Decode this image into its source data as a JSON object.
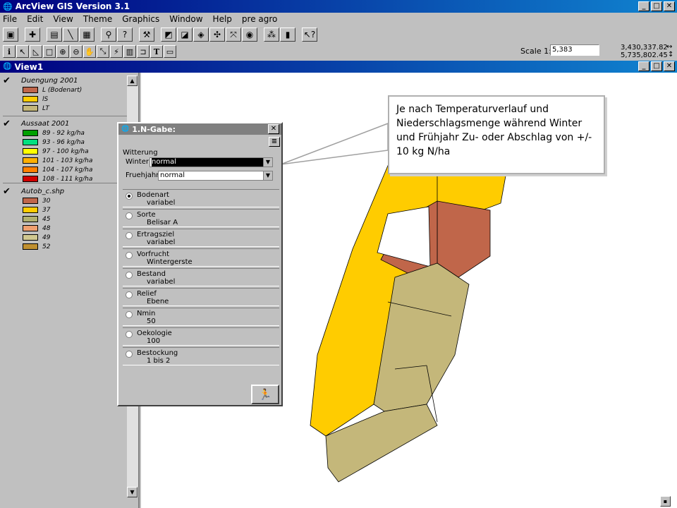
{
  "app": {
    "title": "ArcView GIS Version 3.1",
    "window_buttons": [
      "_",
      "□",
      "✕"
    ]
  },
  "menu": [
    "File",
    "Edit",
    "View",
    "Theme",
    "Graphics",
    "Window",
    "Help",
    "pre agro"
  ],
  "toolbar1_icons": [
    "save-icon",
    "add-theme-icon",
    "properties-icon",
    "edit-legend-icon",
    "table-icon",
    "find-icon",
    "query-icon",
    "hammer-icon",
    "select-icon",
    "select-all-icon",
    "zoom-extent-icon",
    "zoom-in-icon",
    "zoom-out-icon",
    "previous-extent-icon",
    "layout-icon",
    "locate-icon",
    "help-icon"
  ],
  "toolbar2_icons": [
    "identify-icon",
    "pointer-icon",
    "vertex-icon",
    "select-feature-icon",
    "zoom-in-tool-icon",
    "zoom-out-tool-icon",
    "pan-icon",
    "measure-icon",
    "hotlink-icon",
    "area-select-icon",
    "label-icon",
    "text-icon",
    "draw-icon"
  ],
  "scale": {
    "label": "Scale 1:",
    "value": "5,383",
    "coord_x": "3,430,337.82",
    "coord_y": "5,735,802.45"
  },
  "view_window": {
    "title": "View1"
  },
  "legend": [
    {
      "title": "Duengung 2001",
      "items": [
        {
          "label": "L (Bodenart)",
          "color": "#c0664a"
        },
        {
          "label": "lS",
          "color": "#ffcc00"
        },
        {
          "label": "LT",
          "color": "#c4b77a"
        }
      ]
    },
    {
      "title": "Aussaat 2001",
      "items": [
        {
          "label": "89 - 92 kg/ha",
          "color": "#00a000"
        },
        {
          "label": "93 - 96 kg/ha",
          "color": "#00e080"
        },
        {
          "label": "97 - 100 kg/ha",
          "color": "#ffff00"
        },
        {
          "label": "101 - 103 kg/ha",
          "color": "#ffb000"
        },
        {
          "label": "104 - 107 kg/ha",
          "color": "#ff8000"
        },
        {
          "label": "108 - 111 kg/ha",
          "color": "#d00000"
        }
      ]
    },
    {
      "title": "Autob_c.shp",
      "items": [
        {
          "label": "30",
          "color": "#c0664a"
        },
        {
          "label": "37",
          "color": "#ffcc00"
        },
        {
          "label": "45",
          "color": "#b0b070"
        },
        {
          "label": "48",
          "color": "#f0a070"
        },
        {
          "label": "49",
          "color": "#d0c890"
        },
        {
          "label": "52",
          "color": "#c09030"
        }
      ]
    }
  ],
  "dialog": {
    "title": "1.N-Gabe:",
    "group_label": "Witterung",
    "winter_label": "Winter",
    "winter_value": "normal",
    "fruehjahr_label": "Fruehjahr",
    "fruehjahr_value": "normal",
    "options": [
      {
        "name": "Bodenart",
        "value": "variabel",
        "selected": true
      },
      {
        "name": "Sorte",
        "value": "Belisar A",
        "selected": false
      },
      {
        "name": "Ertragsziel",
        "value": "variabel",
        "selected": false
      },
      {
        "name": "Vorfrucht",
        "value": "Wintergerste",
        "selected": false
      },
      {
        "name": "Bestand",
        "value": "variabel",
        "selected": false
      },
      {
        "name": "Relief",
        "value": "Ebene",
        "selected": false
      },
      {
        "name": "Nmin",
        "value": "50",
        "selected": false
      },
      {
        "name": "Oekologie",
        "value": "100",
        "selected": false
      },
      {
        "name": "Bestockung",
        "value": "1 bis 2",
        "selected": false
      }
    ],
    "run_icon": "running-man-icon"
  },
  "callout": {
    "text": "Je nach Temperaturverlauf und Niederschlagsmenge während Winter und Frühjahr Zu- oder Abschlag von +/- 10 kg N/ha"
  },
  "map_colors": {
    "yellow": "#ffcc00",
    "olive": "#c4b77a",
    "brown": "#c0664a"
  }
}
